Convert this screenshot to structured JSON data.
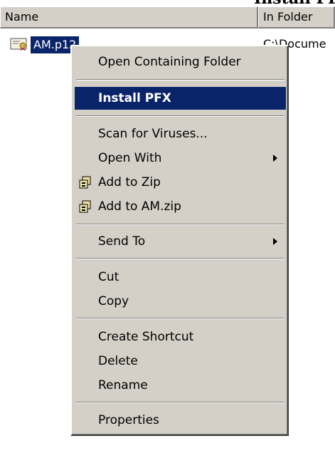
{
  "caption": {
    "text": "Install PFX"
  },
  "columns": {
    "name": "Name",
    "in_folder": "In Folder"
  },
  "file": {
    "name": "AM.p12",
    "folder": "C:\\Docume",
    "icon": "certificate-file-icon"
  },
  "menu": {
    "open_containing_folder": "Open Containing Folder",
    "install_pfx": "Install PFX",
    "scan_for_viruses": "Scan for Viruses...",
    "open_with": "Open With",
    "add_to_zip": "Add to Zip",
    "add_to_am_zip": "Add to AM.zip",
    "send_to": "Send To",
    "cut": "Cut",
    "copy": "Copy",
    "create_shortcut": "Create Shortcut",
    "delete": "Delete",
    "rename": "Rename",
    "properties": "Properties"
  },
  "colors": {
    "highlight": "#0a246a",
    "menu_face": "#d4d0c8",
    "text": "#000000",
    "highlight_text": "#ffffff"
  }
}
